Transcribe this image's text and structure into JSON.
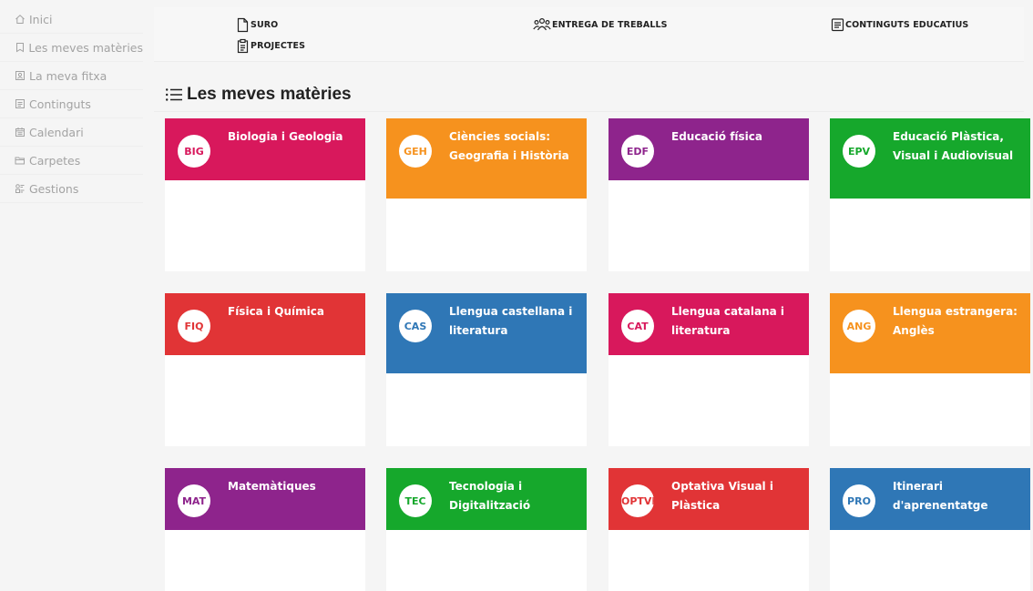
{
  "sidebar": {
    "items": [
      {
        "label": "Inici",
        "icon": "home-icon"
      },
      {
        "label": "Les meves matèries",
        "icon": "bookmark-icon"
      },
      {
        "label": "La meva fitxa",
        "icon": "profile-icon"
      },
      {
        "label": "Continguts",
        "icon": "document-icon"
      },
      {
        "label": "Calendari",
        "icon": "calendar-icon"
      },
      {
        "label": "Carpetes",
        "icon": "folder-icon"
      },
      {
        "label": "Gestions",
        "icon": "tasks-icon"
      }
    ]
  },
  "topbar": {
    "links": [
      {
        "label": "SURO",
        "icon": "file-icon"
      },
      {
        "label": "PROJECTES",
        "icon": "clipboard-icon"
      },
      {
        "label": "ENTREGA DE TREBALLS",
        "icon": "users-icon"
      },
      {
        "label": "CONTINGUTS EDUCATIUS",
        "icon": "document-icon"
      }
    ]
  },
  "section": {
    "title": "Les meves matèries",
    "icon": "list-icon"
  },
  "subjects": [
    {
      "code": "BIG",
      "name": "Biologia i Geologia",
      "color": "#d8185c"
    },
    {
      "code": "GEH",
      "name": "Ciències socials: Geografia i Història",
      "color": "#f6921e"
    },
    {
      "code": "EDF",
      "name": "Educació física",
      "color": "#8e248c"
    },
    {
      "code": "EPV",
      "name": "Educació Plàstica, Visual i Audiovisual",
      "color": "#16a82c"
    },
    {
      "code": "FIQ",
      "name": "Física i Química",
      "color": "#e13436"
    },
    {
      "code": "CAS",
      "name": "Llengua castellana i literatura",
      "color": "#2f77b6"
    },
    {
      "code": "CAT",
      "name": "Llengua catalana i literatura",
      "color": "#d8185c"
    },
    {
      "code": "ANG",
      "name": "Llengua estrangera: Anglès",
      "color": "#f6921e"
    },
    {
      "code": "MAT",
      "name": "Matemàtiques",
      "color": "#8e248c"
    },
    {
      "code": "TEC",
      "name": "Tecnologia i Digitalització",
      "color": "#16a82c"
    },
    {
      "code": "OPTVP",
      "name": "Optativa Visual i Plàstica",
      "color": "#e13436"
    },
    {
      "code": "PRO",
      "name": "Itinerari d'aprenentatge",
      "color": "#2f77b6"
    }
  ]
}
